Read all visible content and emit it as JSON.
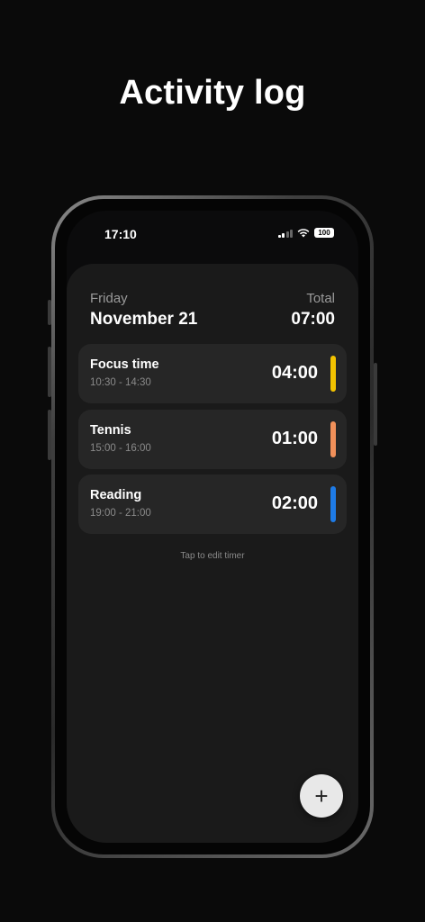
{
  "headline": "Activity log",
  "status_bar": {
    "time": "17:10",
    "battery": "100",
    "icons": [
      "cellular-signal-icon",
      "wifi-icon",
      "battery-icon"
    ]
  },
  "header": {
    "day": "Friday",
    "date": "November 21",
    "total_label": "Total",
    "total_value": "07:00"
  },
  "activities": [
    {
      "name": "Focus time",
      "range": "10:30 - 14:30",
      "duration": "04:00",
      "color": "#f2c200"
    },
    {
      "name": "Tennis",
      "range": "15:00 - 16:00",
      "duration": "01:00",
      "color": "#f0905a"
    },
    {
      "name": "Reading",
      "range": "19:00 - 21:00",
      "duration": "02:00",
      "color": "#1e7be6"
    }
  ],
  "hint": "Tap to edit timer",
  "fab": {
    "icon": "plus-icon",
    "label": "+"
  },
  "colors": {
    "background": "#0a0a0a",
    "sheet": "#1a1a1a",
    "card": "#262626"
  }
}
